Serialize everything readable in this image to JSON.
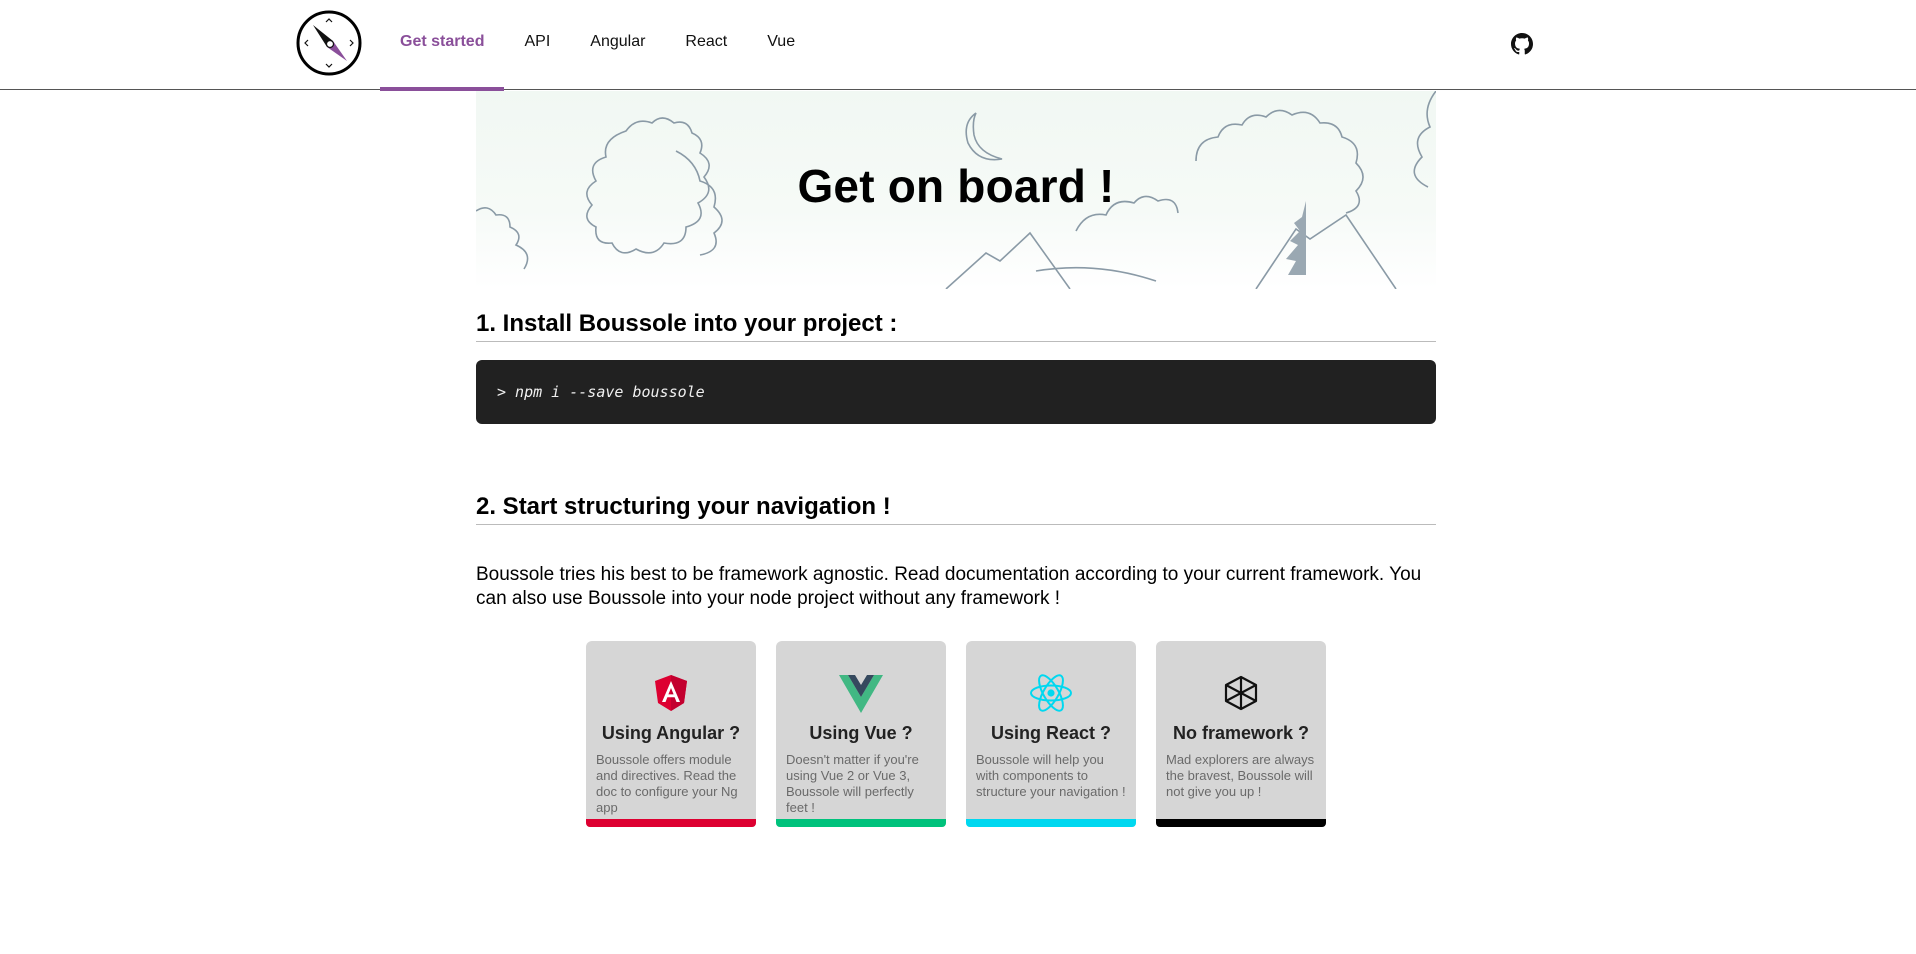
{
  "nav": {
    "items": [
      {
        "label": "Get started",
        "active": true
      },
      {
        "label": "API",
        "active": false
      },
      {
        "label": "Angular",
        "active": false
      },
      {
        "label": "React",
        "active": false
      },
      {
        "label": "Vue",
        "active": false
      }
    ],
    "github_icon": "github-icon",
    "logo_icon": "compass-logo-icon",
    "accent": "#8a4f9a"
  },
  "hero": {
    "title": "Get on board !"
  },
  "install": {
    "heading": "1. Install Boussole into your project :",
    "command": "> npm i --save boussole"
  },
  "structure": {
    "heading": "2. Start structuring your navigation !",
    "description": "Boussole tries his best to be framework agnostic. Read documentation according to your current framework. You can also use Boussole into your node project without any framework !"
  },
  "cards": [
    {
      "title": "Using Angular ?",
      "text": "Boussole offers module and directives. Read the doc to configure your Ng app",
      "icon": "angular-icon",
      "color": "#dd0031"
    },
    {
      "title": "Using Vue ?",
      "text": "Doesn't matter if you're using Vue 2 or Vue 3, Boussole will perfectly feet !",
      "icon": "vue-icon",
      "color": "#00c27c"
    },
    {
      "title": "Using React ?",
      "text": "Boussole will help you with components to structure your navigation !",
      "icon": "react-icon",
      "color": "#00d8f0"
    },
    {
      "title": "No framework ?",
      "text": "Mad explorers are always the bravest, Boussole will not give you up !",
      "icon": "cube-icon",
      "color": "#000000"
    }
  ]
}
